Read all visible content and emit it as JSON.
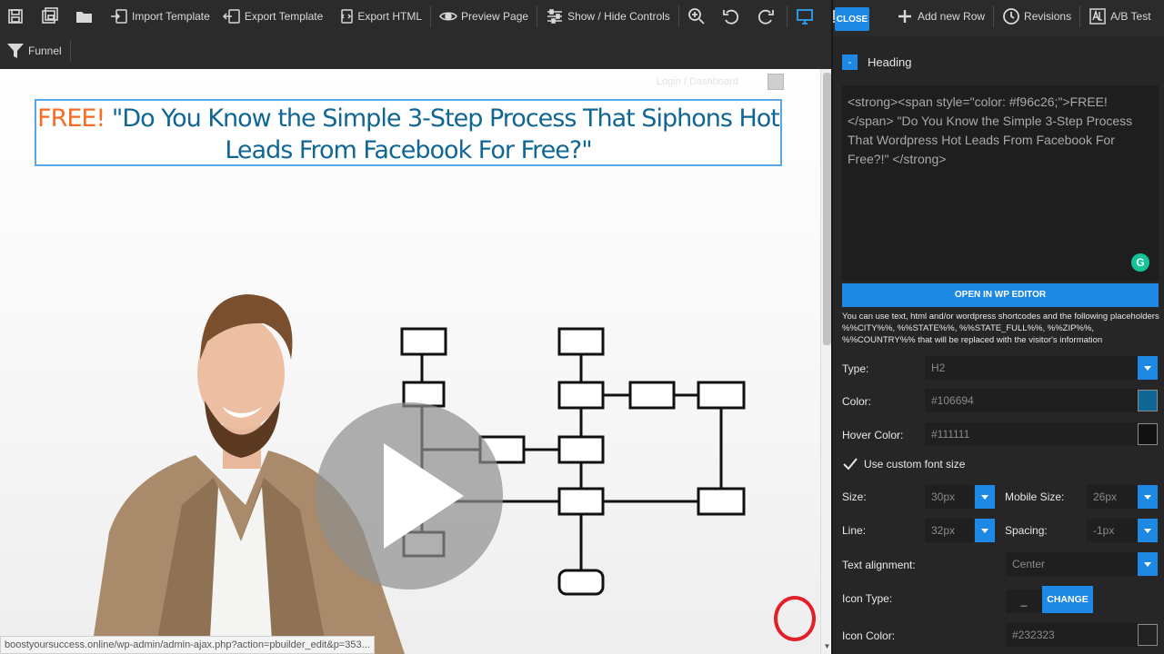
{
  "toolbar": {
    "row1": [
      {
        "label": "",
        "icon": "save-icon"
      },
      {
        "label": "",
        "icon": "save-as-icon"
      },
      {
        "label": "",
        "icon": "open-folder-icon"
      },
      {
        "label": "Import Template",
        "icon": "import-template-icon"
      },
      {
        "label": "Export Template",
        "icon": "export-template-icon"
      },
      {
        "label": "Export HTML",
        "icon": "export-html-icon"
      },
      {
        "label": "Preview Page",
        "icon": "eye-icon"
      },
      {
        "label": "Show / Hide Controls",
        "icon": "sliders-icon"
      },
      {
        "label": "",
        "icon": "zoom-in-icon"
      },
      {
        "label": "",
        "icon": "undo-icon"
      },
      {
        "label": "",
        "icon": "redo-icon"
      },
      {
        "label": "",
        "icon": "desktop-icon"
      },
      {
        "label": "",
        "icon": "laptop-icon"
      }
    ],
    "right": [
      {
        "label": "Add new Row",
        "icon": "plus-icon"
      },
      {
        "label": "Revisions",
        "icon": "clock-icon"
      },
      {
        "label": "A/B Test",
        "icon": "ab-test-icon"
      }
    ],
    "row2": [
      {
        "label": "Funnel",
        "icon": "funnel-icon"
      }
    ],
    "close_label": "CLOSE"
  },
  "canvas": {
    "headline_free": "FREE!",
    "headline_rest": "\"Do You Know the Simple 3-Step Process That Siphons Hot Leads From Facebook For Free?\"",
    "faint_text": "Login / Dashboard",
    "status_url": "boostyoursuccess.online/wp-admin/admin-ajax.php?action=pbuilder_edit&p=353..."
  },
  "panel": {
    "section_title": "Heading",
    "collapse_label": "-",
    "code": "<strong><span style=\"color: #f96c26;\">FREE!</span> \"Do You Know the Simple 3-Step Process That Wordpress Hot Leads From Facebook For Free?!\" </strong>",
    "wp_editor_label": "OPEN IN WP EDITOR",
    "hint": "You can use text, html and/or wordpress shortcodes and the following placeholders %%CITY%%, %%STATE%%, %%STATE_FULL%%, %%ZIP%%, %%COUNTRY%% that will be replaced with the visitor's information",
    "grammarly": "G",
    "type_label": "Type:",
    "type_value": "H2",
    "color_label": "Color:",
    "color_value": "#106694",
    "color_swatch": "#106694",
    "hover_label": "Hover Color:",
    "hover_value": "#111111",
    "hover_swatch": "#111111",
    "custom_font_label": "Use custom font size",
    "size_label": "Size:",
    "size_value": "30px",
    "mobile_size_label": "Mobile Size:",
    "mobile_size_value": "26px",
    "line_label": "Line:",
    "line_value": "32px",
    "spacing_label": "Spacing:",
    "spacing_value": "-1px",
    "align_label": "Text alignment:",
    "align_value": "Center",
    "icon_type_label": "Icon Type:",
    "icon_type_dash": "_",
    "change_label": "CHANGE",
    "icon_color_label": "Icon Color:",
    "icon_color_value": "#232323",
    "icon_color_swatch": "#232323"
  }
}
